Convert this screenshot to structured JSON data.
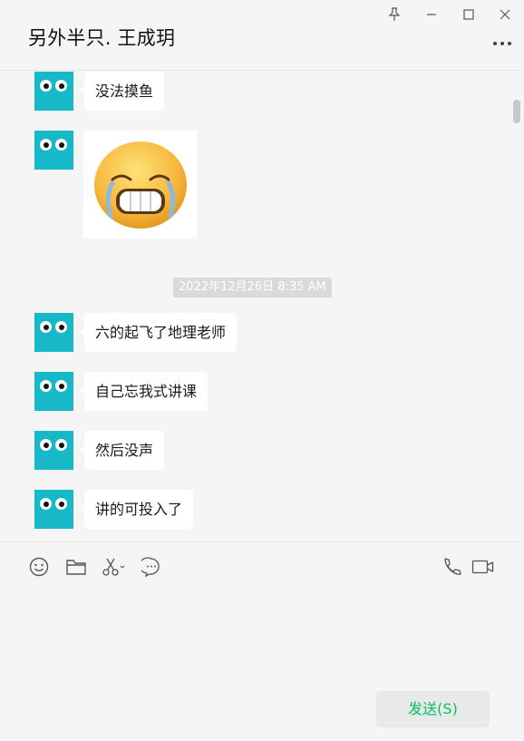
{
  "window": {
    "title": "另外半只. 王成玥"
  },
  "chat": {
    "messages": [
      {
        "type": "text",
        "text": "没法摸鱼"
      },
      {
        "type": "sticker",
        "sticker": "grimacing-crying-emoji"
      },
      {
        "type": "text",
        "text": "六的起飞了地理老师"
      },
      {
        "type": "text",
        "text": "自己忘我式讲课"
      },
      {
        "type": "text",
        "text": "然后没声"
      },
      {
        "type": "text",
        "text": "讲的可投入了"
      }
    ],
    "timestamp": "2022年12月26日 8:35 AM"
  },
  "toolbar": {
    "icons": [
      "emoji-icon",
      "folder-icon",
      "scissors-icon",
      "chat-history-icon",
      "phone-icon",
      "video-call-icon"
    ]
  },
  "send_button": {
    "label": "发送(S)"
  },
  "colors": {
    "avatar": "#17b9c8",
    "send_text": "#07c160",
    "background": "#f5f5f5"
  }
}
